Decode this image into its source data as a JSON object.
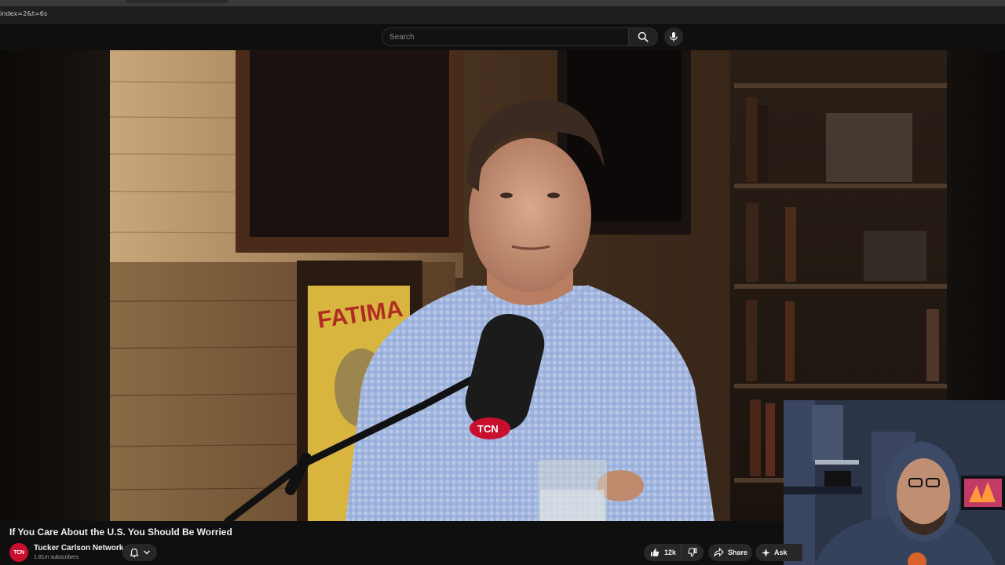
{
  "browser": {
    "url_fragment": "index=2&t=6s"
  },
  "masthead": {
    "search_placeholder": "Search",
    "search_icon": "search-icon",
    "mic_icon": "mic-icon"
  },
  "video": {
    "title": "If You Care About the U.S. You Should Be Worried",
    "poster_text": "FATIMA",
    "mic_brand": "TCN"
  },
  "channel": {
    "avatar_text": "TCN",
    "name": "Tucker Carlson Network",
    "subscribers": "1.81m subscribers",
    "avatar_color": "#c8102e"
  },
  "actions": {
    "like_count": "12k",
    "share_label": "Share",
    "ask_label": "Ask"
  },
  "colors": {
    "background": "#0f0f0f",
    "button_bg": "#272727",
    "text": "#f1f1f1",
    "secondary_text": "#aaaaaa"
  }
}
